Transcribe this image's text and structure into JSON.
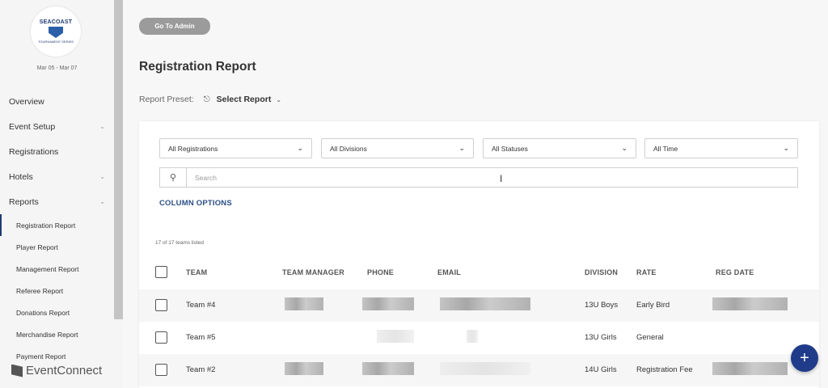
{
  "sidebar": {
    "logo": {
      "brand": "SEACOAST",
      "sub": "TOURNAMENT SERIES"
    },
    "dates": "Mar 05 - Mar 07",
    "nav": [
      {
        "label": "Overview",
        "chevron": false
      },
      {
        "label": "Event Setup",
        "chevron": true
      },
      {
        "label": "Registrations",
        "chevron": false
      },
      {
        "label": "Hotels",
        "chevron": true
      },
      {
        "label": "Reports",
        "chevron": true
      }
    ],
    "reports_sub": [
      "Registration Report",
      "Player Report",
      "Management Report",
      "Referee Report",
      "Donations Report",
      "Merchandise Report",
      "Payment Report"
    ],
    "active_sub": "Registration Report",
    "footer_brand": "EventConnect"
  },
  "main": {
    "admin_button": "Go To Admin",
    "title": "Registration Report",
    "preset_label": "Report Preset:",
    "preset_value": "Select Report",
    "filters": [
      "All Registrations",
      "All Divisions",
      "All Statuses",
      "All Time"
    ],
    "search_placeholder": "Search",
    "column_options": "COLUMN OPTIONS",
    "count_text": "17 of 17 teams listed",
    "columns": [
      "TEAM",
      "TEAM MANAGER",
      "PHONE",
      "EMAIL",
      "DIVISION",
      "RATE",
      "REG DATE"
    ],
    "rows": [
      {
        "team": "Team #4",
        "division": "13U Boys",
        "rate": "Early Bird"
      },
      {
        "team": "Team #5",
        "division": "13U Girls",
        "rate": "General"
      },
      {
        "team": "Team #2",
        "division": "14U Girls",
        "rate": "Registration Fee"
      }
    ],
    "fab_label": "+"
  },
  "icons": {
    "chevron": "chevron-down-icon",
    "search": "search-icon",
    "preset": "bookmark-icon",
    "fab": "plus-icon"
  },
  "colors": {
    "accent": "#1f3b8a",
    "link": "#2c4f86",
    "admin_button": "#9b9b9b"
  }
}
